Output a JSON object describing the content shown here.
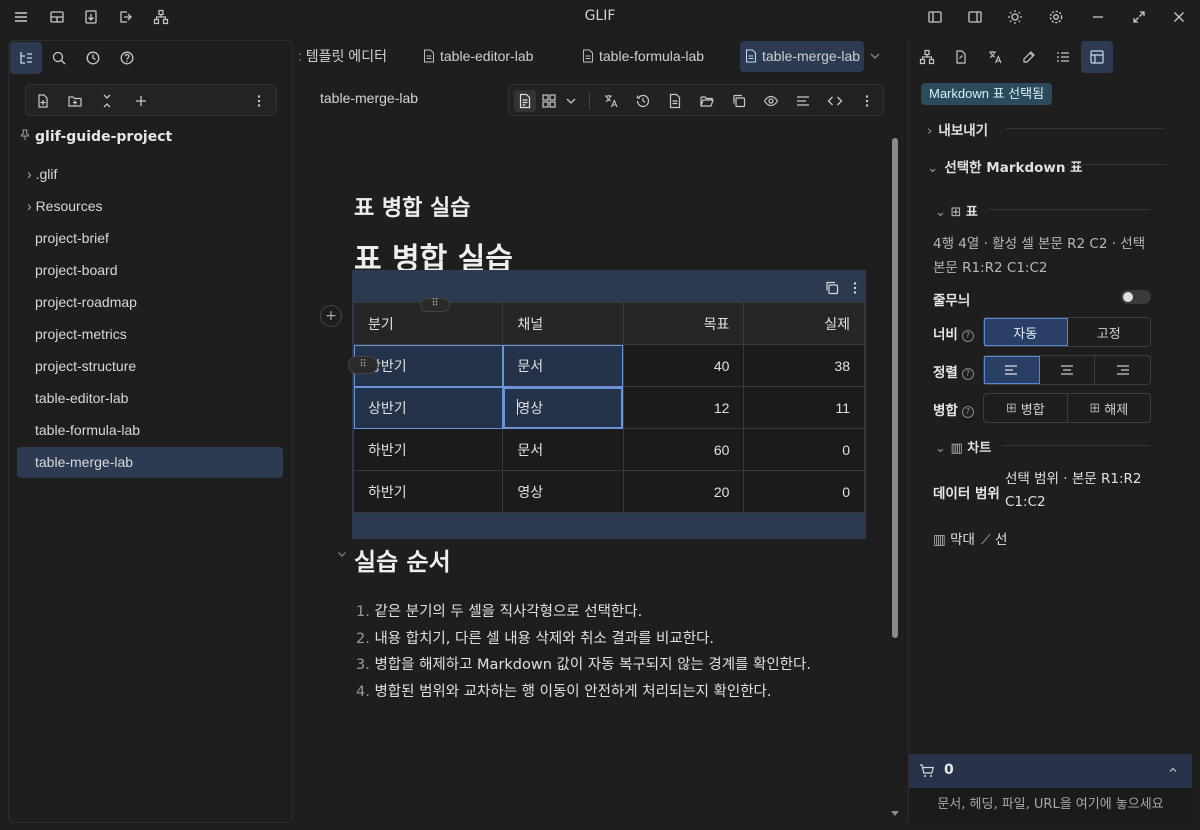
{
  "app": {
    "title": "GLIF"
  },
  "sidebar": {
    "project_name": "glif-guide-project",
    "tree": [
      {
        "label": ".glif",
        "kind": "folder"
      },
      {
        "label": "Resources",
        "kind": "folder"
      },
      {
        "label": "project-brief",
        "kind": "file"
      },
      {
        "label": "project-board",
        "kind": "file"
      },
      {
        "label": "project-roadmap",
        "kind": "file"
      },
      {
        "label": "project-metrics",
        "kind": "file"
      },
      {
        "label": "project-structure",
        "kind": "file"
      },
      {
        "label": "table-editor-lab",
        "kind": "file"
      },
      {
        "label": "table-formula-lab",
        "kind": "file"
      },
      {
        "label": "table-merge-lab",
        "kind": "file",
        "active": true
      }
    ]
  },
  "tabs": [
    {
      "label": "템플릿 에디터",
      "truncated_prefix": ":"
    },
    {
      "label": "table-editor-lab"
    },
    {
      "label": "table-formula-lab"
    },
    {
      "label": "table-merge-lab",
      "active": true
    }
  ],
  "editor": {
    "doc_label": "table-merge-lab",
    "heading_small": "표 병합 실습",
    "heading_large": "표 병합 실습",
    "table": {
      "headers": [
        "분기",
        "채널",
        "목표",
        "실제"
      ],
      "rows": [
        [
          "상반기",
          "문서",
          "40",
          "38"
        ],
        [
          "상반기",
          "영상",
          "12",
          "11"
        ],
        [
          "하반기",
          "문서",
          "60",
          "0"
        ],
        [
          "하반기",
          "영상",
          "20",
          "0"
        ]
      ]
    },
    "section_heading": "실습 순서",
    "steps": [
      {
        "n": "1.",
        "text": "같은 분기의 두 셀을 직사각형으로 선택한다."
      },
      {
        "n": "2.",
        "text": "내용 합치기, 다른 셀 내용 삭제와 취소 결과를 비교한다."
      },
      {
        "n": "3.",
        "text": "병합을 해제하고 Markdown 값이 자동 복구되지 않는 경계를 확인한다."
      },
      {
        "n": "4.",
        "text": "병합된 범위와 교차하는 행 이동이 안전하게 처리되는지 확인한다."
      }
    ]
  },
  "panel": {
    "badge": "Markdown 표 선택됨",
    "export_label": "내보내기",
    "selected_table_label": "선택한 Markdown 표",
    "table_section": "표",
    "table_info": "4행 4열 · 활성 셀 본문 R2 C2 · 선택 본문 R1:R2 C1:C2",
    "stripe_label": "줄무늬",
    "stripe_on": false,
    "width_label": "너비",
    "width_options": [
      "자동",
      "고정"
    ],
    "align_label": "정렬",
    "merge_label": "병합",
    "merge_button": "병합",
    "unmerge_button": "해제",
    "chart_section": "차트",
    "data_range_label": "데이터 범위",
    "data_range_value": "선택 범위 · 본문 R1:R2 C1:C2",
    "chart_bar": "막대",
    "chart_line": "선",
    "cart_count": "0",
    "dropzone": "문서, 헤딩, 파일, URL을 여기에 놓으세요"
  }
}
